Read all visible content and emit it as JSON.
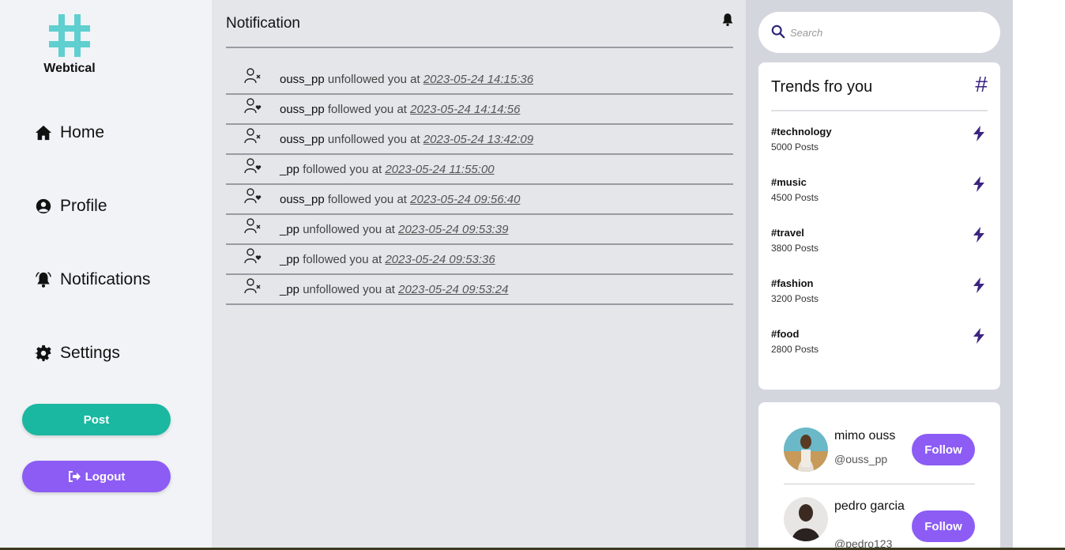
{
  "brand": {
    "name": "Webtical",
    "logo_color": "#5fcfcf"
  },
  "nav": [
    {
      "label": "Home",
      "icon": "home-icon"
    },
    {
      "label": "Profile",
      "icon": "user-circle-icon"
    },
    {
      "label": "Notifications",
      "icon": "bell-icon"
    },
    {
      "label": "Settings",
      "icon": "gear-icon"
    }
  ],
  "actions": {
    "post_label": "Post",
    "logout_label": "Logout"
  },
  "main": {
    "title": "Notification",
    "notifications": [
      {
        "user": "ouss_pp",
        "action": "unfollowed you at",
        "time": "2023-05-24 14:15:36",
        "icon": "user-x-icon"
      },
      {
        "user": "ouss_pp",
        "action": "followed you at",
        "time": "2023-05-24 14:14:56",
        "icon": "user-heart-icon"
      },
      {
        "user": "ouss_pp",
        "action": "unfollowed you at",
        "time": "2023-05-24 13:42:09",
        "icon": "user-x-icon"
      },
      {
        "user": "_pp",
        "action": "followed you at",
        "time": "2023-05-24 11:55:00",
        "icon": "user-heart-icon"
      },
      {
        "user": "ouss_pp",
        "action": "followed you at",
        "time": "2023-05-24 09:56:40",
        "icon": "user-heart-icon"
      },
      {
        "user": "_pp",
        "action": "unfollowed you at",
        "time": "2023-05-24 09:53:39",
        "icon": "user-x-icon"
      },
      {
        "user": "_pp",
        "action": "followed you at",
        "time": "2023-05-24 09:53:36",
        "icon": "user-heart-icon"
      },
      {
        "user": "_pp",
        "action": "unfollowed you at",
        "time": "2023-05-24 09:53:24",
        "icon": "user-x-icon"
      }
    ]
  },
  "search": {
    "placeholder": "Search"
  },
  "trends": {
    "title": "Trends fro you",
    "items": [
      {
        "tag": "#technology",
        "count": "5000 Posts"
      },
      {
        "tag": "#music",
        "count": "4500 Posts"
      },
      {
        "tag": "#travel",
        "count": "3800 Posts"
      },
      {
        "tag": "#fashion",
        "count": "3200 Posts"
      },
      {
        "tag": "#food",
        "count": "2800 Posts"
      }
    ]
  },
  "suggestions": [
    {
      "name": "mimo ouss",
      "handle": "@ouss_pp",
      "follow_label": "Follow"
    },
    {
      "name": "pedro garcia",
      "handle": "@pedro123",
      "follow_label": "Follow"
    }
  ],
  "colors": {
    "accent_teal": "#1ab8a0",
    "accent_purple": "#8c5cf5",
    "trend_icon": "#3b2480"
  }
}
